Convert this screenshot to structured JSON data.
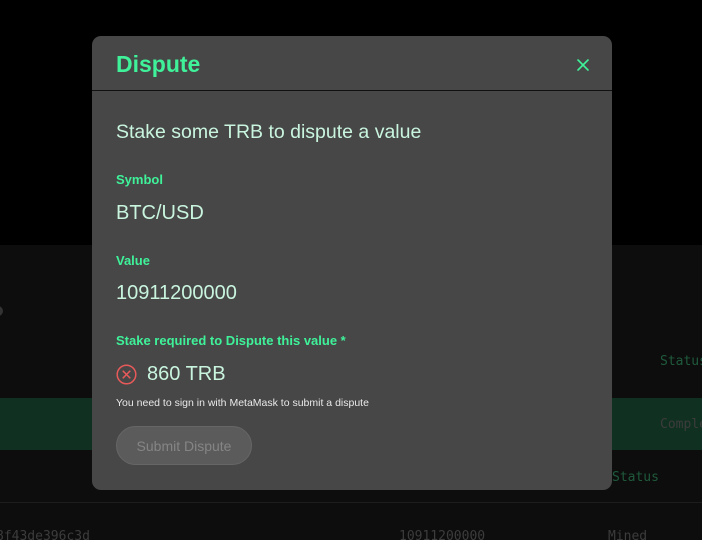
{
  "background": {
    "header_status": "Status",
    "row_status": "Comple",
    "sub_header_status": "Status",
    "row_hash": "8f43de396c3d",
    "row_value": "10911200000",
    "row_state": "Mined"
  },
  "modal": {
    "title": "Dispute",
    "close_icon": "close-icon",
    "heading": "Stake some TRB to dispute a value",
    "symbol_label": "Symbol",
    "symbol_value": "BTC/USD",
    "value_label": "Value",
    "value_value": "10911200000",
    "stake_label": "Stake required to Dispute this value *",
    "stake_value": "860 TRB",
    "stake_icon": "error-circle-icon",
    "note": "You need to sign in with MetaMask to submit a dispute",
    "submit_label": "Submit Dispute"
  },
  "colors": {
    "accent": "#3ff29a",
    "modal_bg": "#474747",
    "error": "#e85a5a"
  }
}
